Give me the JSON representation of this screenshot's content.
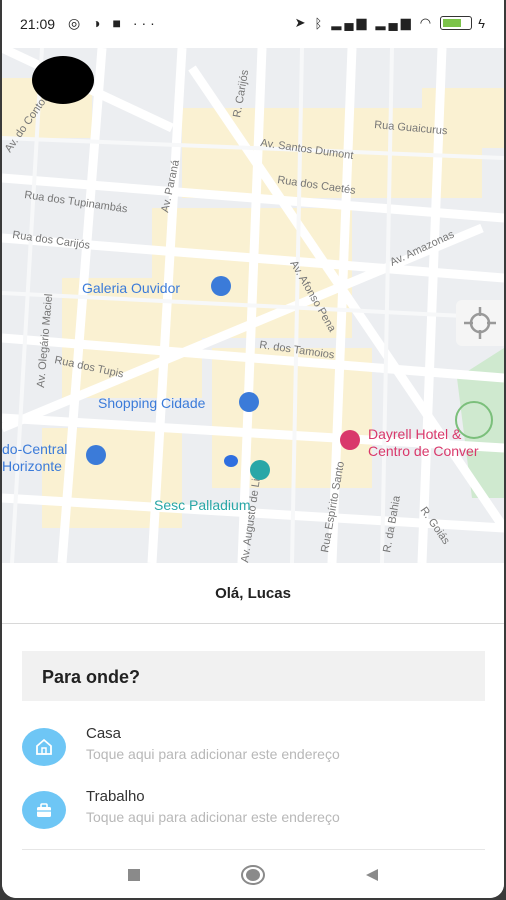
{
  "status": {
    "time": "21:09",
    "left_icons": [
      "whatsapp-icon",
      "circle-half-icon",
      "square-app-icon",
      "more-icon"
    ],
    "right_icons": [
      "location-arrow-icon",
      "bluetooth-icon",
      "signal-icon",
      "signal-icon",
      "wifi-icon",
      "battery-icon",
      "charging-icon"
    ]
  },
  "map": {
    "streets": [
      "Av. do Contorno",
      "R. Carijós",
      "Rua Guaicurus",
      "Av. Santos Dumont",
      "Rua dos Caetés",
      "Rua dos Tupinambás",
      "Av. Paraná",
      "Rua dos Carijós",
      "Av. Amazonas",
      "Av. Afonso Pena",
      "R. dos Tamoios",
      "Av. Olegário Maciel",
      "Rua dos Tupis",
      "R. Goiás",
      "R. da Bahia",
      "Rua Espírito Santo",
      "Av. Augusto de Lima"
    ],
    "pois": [
      "Galeria Ouvidor",
      "Shopping Cidade",
      "do-Central",
      "Horizonte",
      "Dayrell Hotel &",
      "Centro de Conver",
      "Sesc Palladium"
    ],
    "colors": {
      "poi_blue": "#3b7bd9",
      "poi_pink": "#d9386b",
      "poi_teal": "#29a7a7",
      "user_dot": "#2f6fe0"
    }
  },
  "sheet": {
    "greeting": "Olá, Lucas",
    "search_label": "Para onde?",
    "places": [
      {
        "title": "Casa",
        "subtitle": "Toque aqui para adicionar este endereço",
        "icon": "home-icon"
      },
      {
        "title": "Trabalho",
        "subtitle": "Toque aqui para adicionar este endereço",
        "icon": "briefcase-icon"
      }
    ]
  },
  "accent_color": "#6ec6f5"
}
